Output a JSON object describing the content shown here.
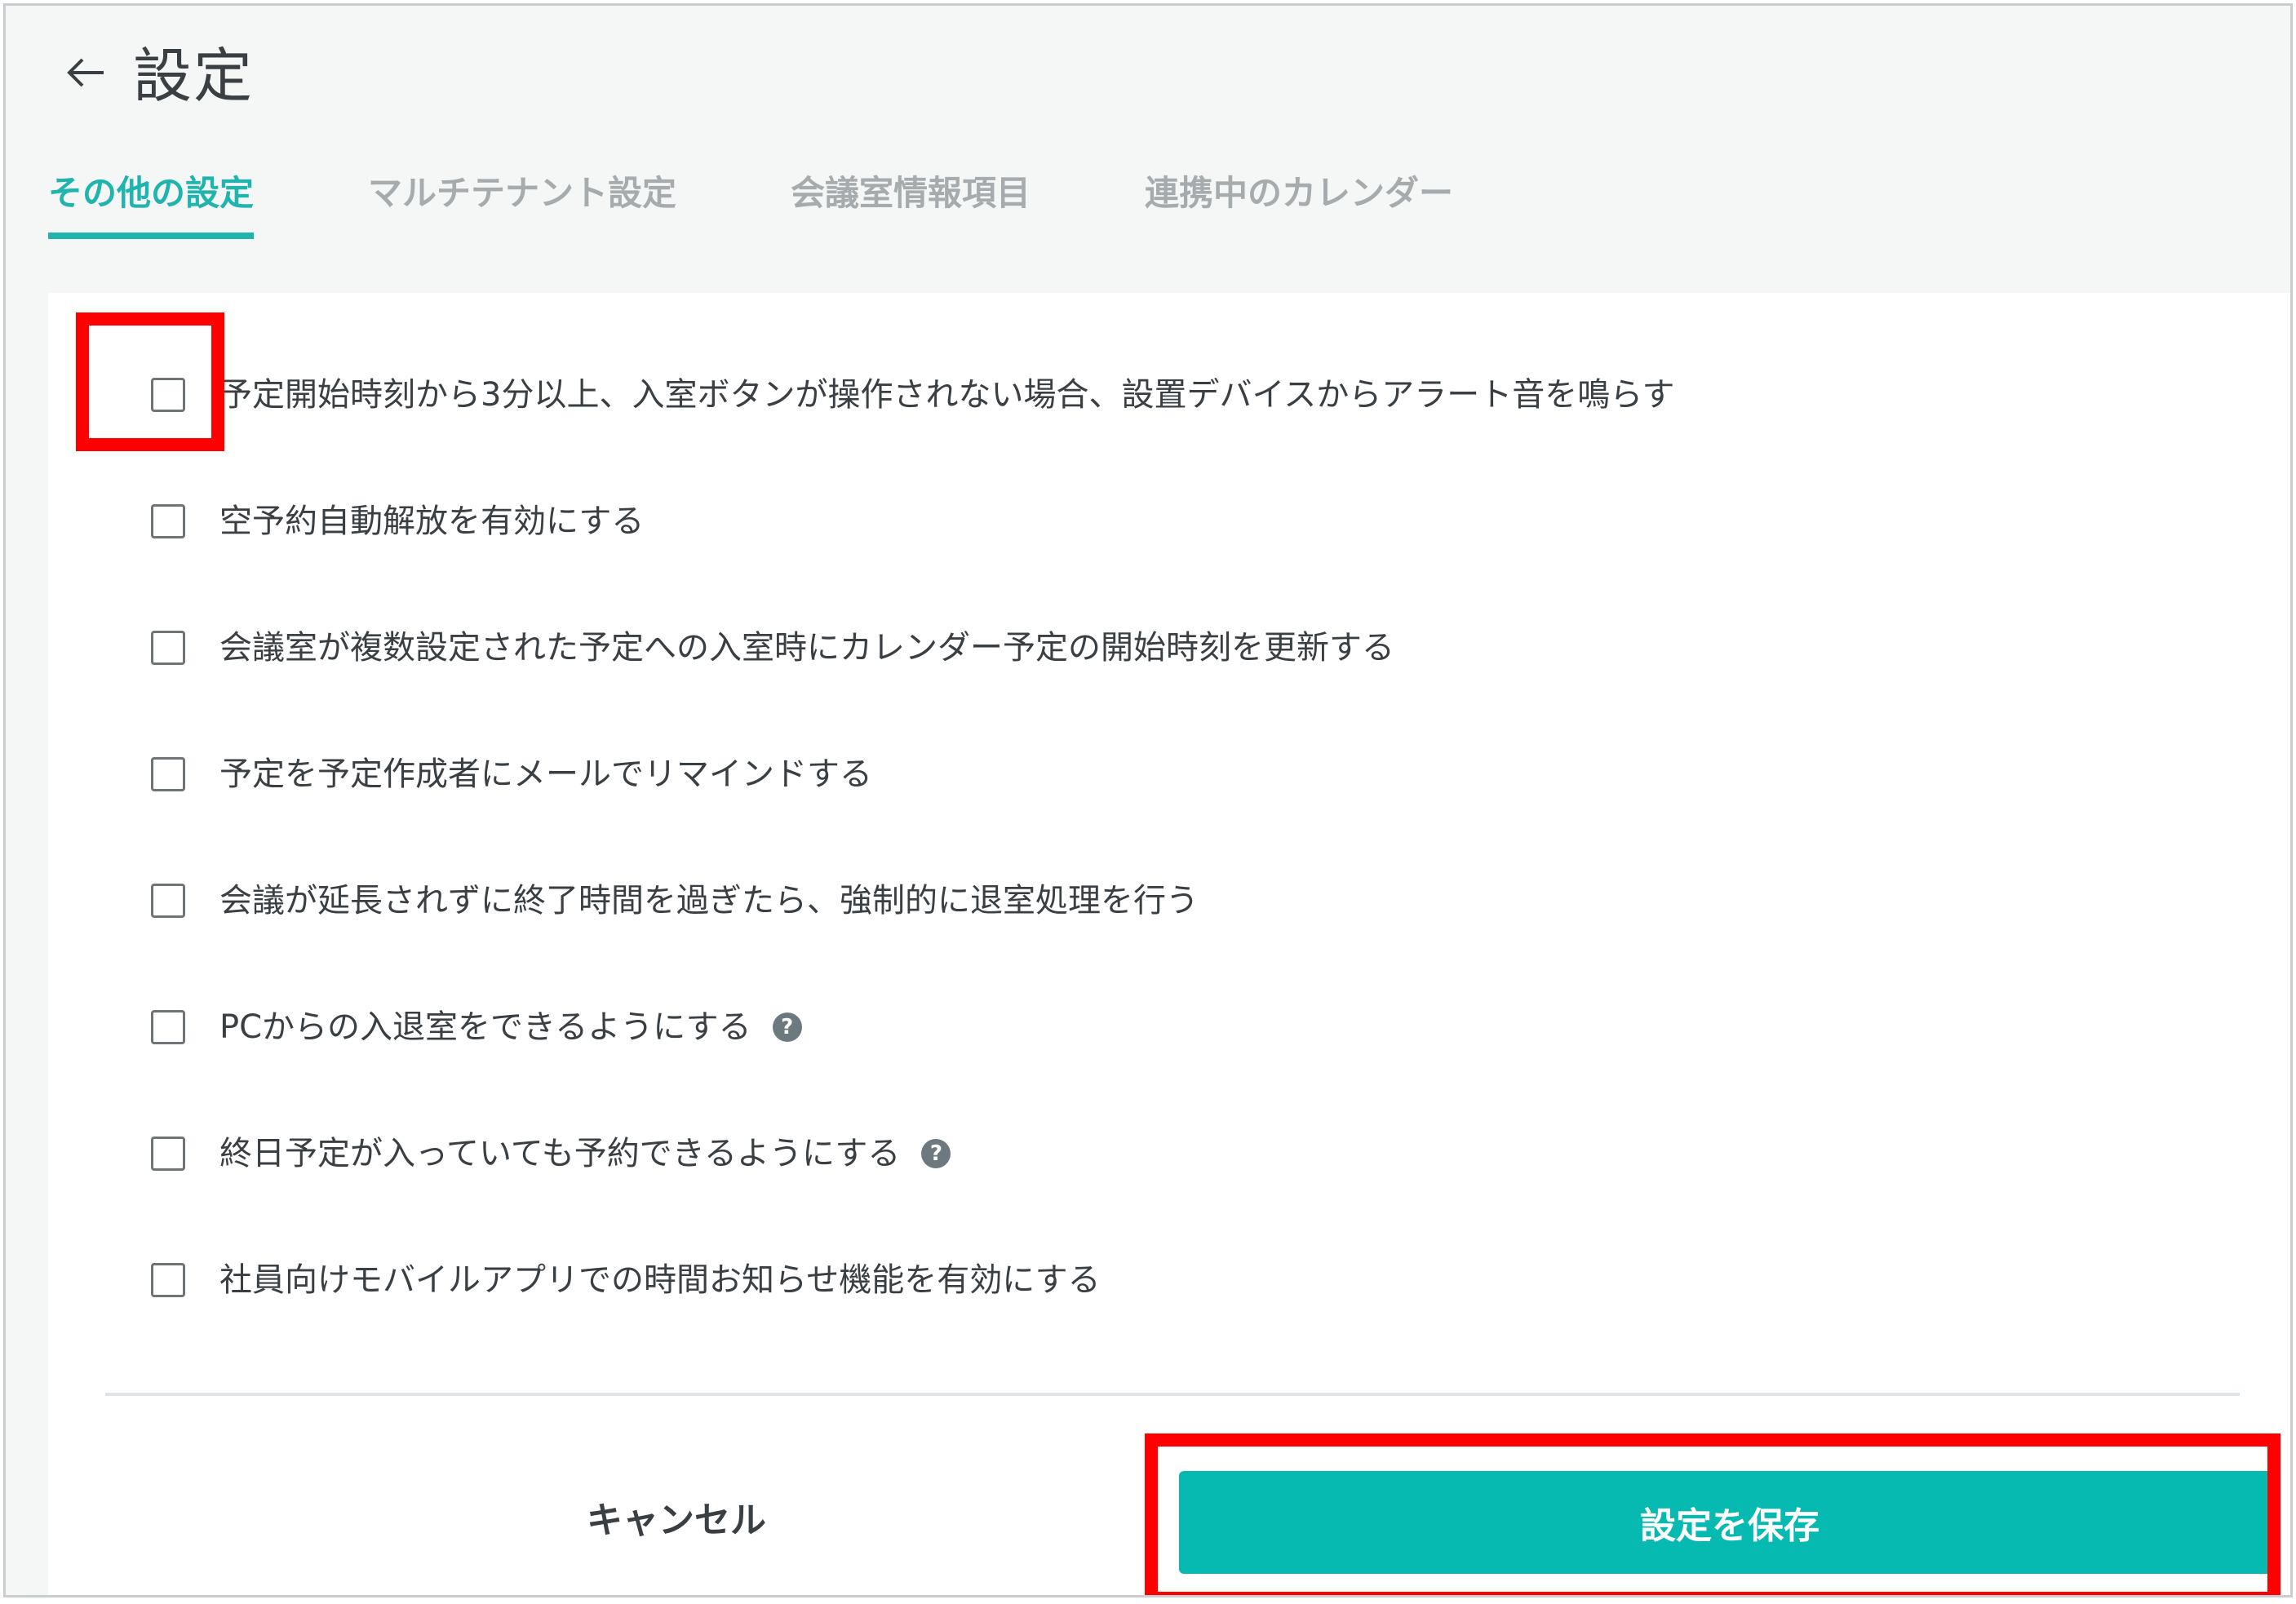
{
  "header": {
    "title": "設定"
  },
  "tabs": [
    {
      "label": "その他の設定",
      "active": true
    },
    {
      "label": "マルチテナント設定",
      "active": false
    },
    {
      "label": "会議室情報項目",
      "active": false
    },
    {
      "label": "連携中のカレンダー",
      "active": false
    }
  ],
  "options": [
    {
      "label": "予定開始時刻から3分以上、入室ボタンが操作されない場合、設置デバイスからアラート音を鳴らす",
      "checked": false
    },
    {
      "label": "空予約自動解放を有効にする",
      "checked": false
    },
    {
      "label": "会議室が複数設定された予定への入室時にカレンダー予定の開始時刻を更新する",
      "checked": false
    },
    {
      "label": "予定を予定作成者にメールでリマインドする",
      "checked": false
    },
    {
      "label": "会議が延長されずに終了時間を過ぎたら、強制的に退室処理を行う",
      "checked": false
    },
    {
      "label": "PCからの入退室をできるようにする",
      "checked": false,
      "help": "?"
    },
    {
      "label": "終日予定が入っていても予約できるようにする",
      "checked": false,
      "help": "?"
    },
    {
      "label": "社員向けモバイルアプリでの時間お知らせ機能を有効にする",
      "checked": false
    }
  ],
  "actions": {
    "cancel_label": "キャンセル",
    "save_label": "設定を保存"
  },
  "colors": {
    "accent": "#1fb4ad",
    "save_button": "#06b9b1",
    "highlight": "#ff0000"
  }
}
